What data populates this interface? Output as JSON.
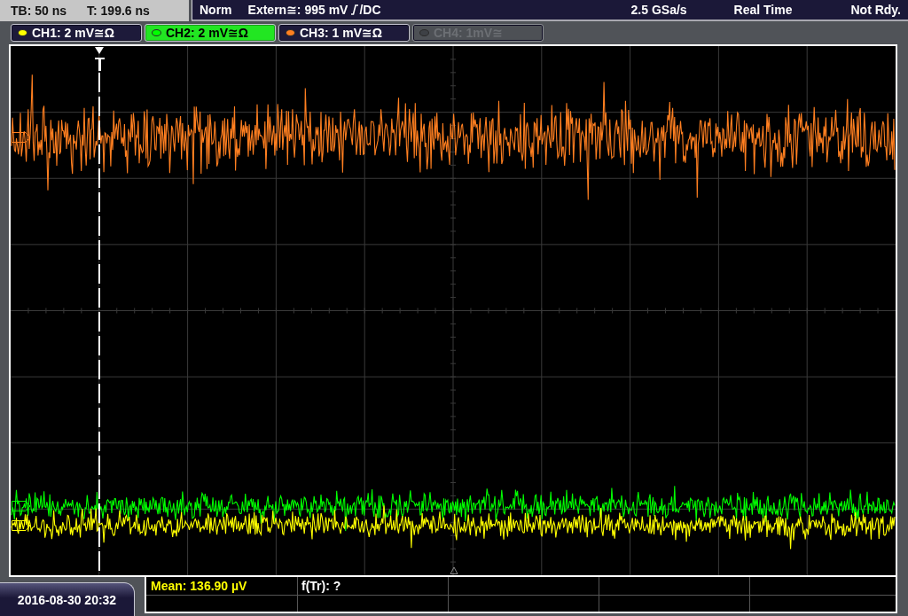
{
  "timebase": {
    "scale": "TB: 50 ns",
    "position": "T: 199.6 ns"
  },
  "trigger": {
    "mode": "Norm",
    "source_level": "Extern≅: 995 mV",
    "coupling": "/DC"
  },
  "acquisition": {
    "sample_rate": "2.5 GSa/s",
    "mode": "Real Time",
    "status": "Not Rdy."
  },
  "channels": [
    {
      "label": "CH1: 2 mV≅Ω",
      "selected": false,
      "on": true,
      "color": "#ffff00"
    },
    {
      "label": "CH2: 2 mV≅Ω",
      "selected": true,
      "on": true,
      "color": "#00ff00"
    },
    {
      "label": "CH3: 1 mV≅Ω",
      "selected": false,
      "on": true,
      "color": "#ff7f20"
    },
    {
      "label": "CH4: 1mV≅",
      "selected": false,
      "on": false,
      "color": "#3e4146"
    }
  ],
  "clock": "2016-08-30 20:32",
  "measurements": [
    {
      "text": "Mean: 136.90 µV",
      "color": "#ffff00"
    },
    {
      "text": "f(Tr): ?",
      "color": "#ffffff"
    }
  ]
}
